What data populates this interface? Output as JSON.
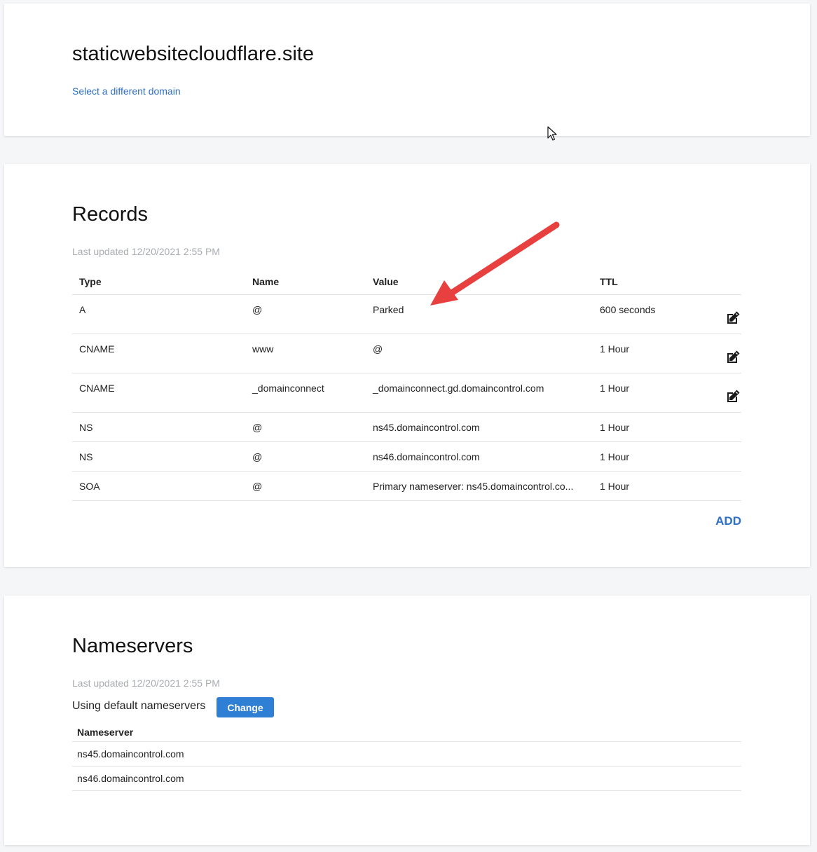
{
  "domain": {
    "name": "staticwebsitecloudflare.site",
    "select_link": "Select a different domain"
  },
  "records": {
    "title": "Records",
    "last_updated": "Last updated 12/20/2021 2:55 PM",
    "columns": [
      "Type",
      "Name",
      "Value",
      "TTL"
    ],
    "rows": [
      {
        "type": "A",
        "name": "@",
        "value": "Parked",
        "ttl": "600 seconds",
        "editable": true
      },
      {
        "type": "CNAME",
        "name": "www",
        "value": "@",
        "ttl": "1 Hour",
        "editable": true
      },
      {
        "type": "CNAME",
        "name": "_domainconnect",
        "value": "_domainconnect.gd.domaincontrol.com",
        "ttl": "1 Hour",
        "editable": true
      },
      {
        "type": "NS",
        "name": "@",
        "value": "ns45.domaincontrol.com",
        "ttl": "1 Hour",
        "editable": false
      },
      {
        "type": "NS",
        "name": "@",
        "value": "ns46.domaincontrol.com",
        "ttl": "1 Hour",
        "editable": false
      },
      {
        "type": "SOA",
        "name": "@",
        "value": "Primary nameserver: ns45.domaincontrol.co...",
        "ttl": "1 Hour",
        "editable": false
      }
    ],
    "add_label": "ADD"
  },
  "nameservers": {
    "title": "Nameservers",
    "last_updated": "Last updated 12/20/2021 2:55 PM",
    "using_label": "Using default nameservers",
    "change_label": "Change",
    "column": "Nameserver",
    "items": [
      "ns45.domaincontrol.com",
      "ns46.domaincontrol.com"
    ]
  },
  "colors": {
    "link": "#2f6fc4",
    "button": "#2f7fd4",
    "annotation_arrow": "#e8403f"
  }
}
